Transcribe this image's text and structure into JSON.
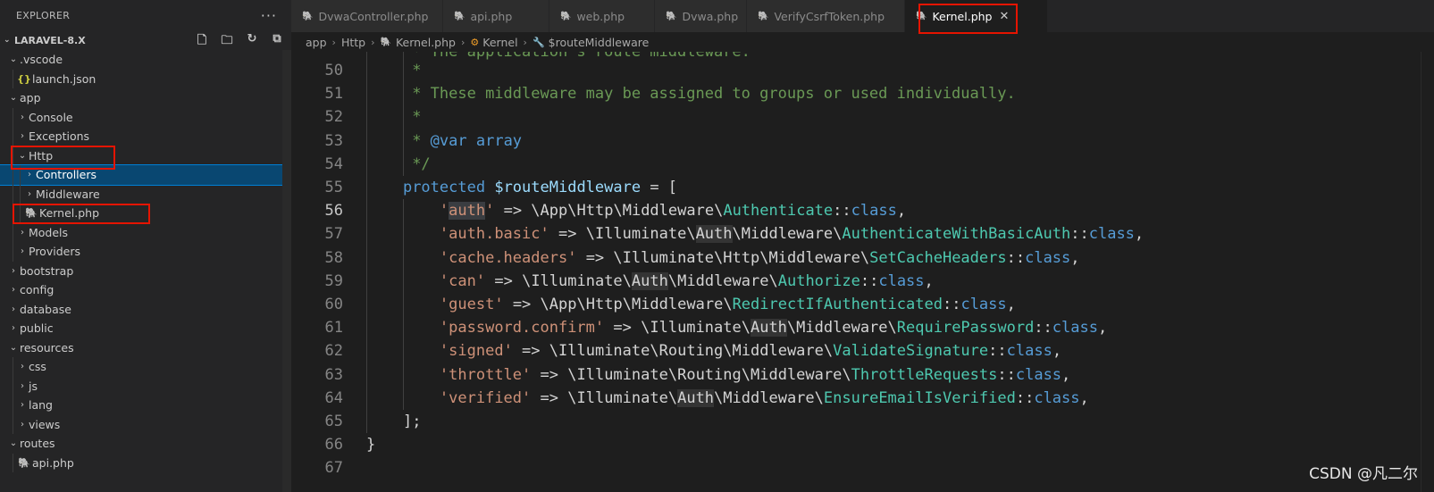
{
  "sidebar": {
    "title": "EXPLORER",
    "more_icon": "ellipsis-icon",
    "project": "LARAVEL-8.X",
    "actions": [
      "new-file-icon",
      "new-folder-icon",
      "refresh-icon",
      "collapse-all-icon"
    ],
    "items": [
      {
        "label": ".vscode",
        "type": "folder",
        "expanded": true
      },
      {
        "label": "launch.json",
        "type": "json"
      },
      {
        "label": "app",
        "type": "folder",
        "expanded": true
      },
      {
        "label": "Console",
        "type": "folder",
        "expanded": false
      },
      {
        "label": "Exceptions",
        "type": "folder",
        "expanded": false
      },
      {
        "label": "Http",
        "type": "folder",
        "expanded": true
      },
      {
        "label": "Controllers",
        "type": "folder",
        "expanded": false
      },
      {
        "label": "Middleware",
        "type": "folder",
        "expanded": false
      },
      {
        "label": "Kernel.php",
        "type": "php"
      },
      {
        "label": "Models",
        "type": "folder",
        "expanded": false
      },
      {
        "label": "Providers",
        "type": "folder",
        "expanded": false
      },
      {
        "label": "bootstrap",
        "type": "folder",
        "expanded": false
      },
      {
        "label": "config",
        "type": "folder",
        "expanded": false
      },
      {
        "label": "database",
        "type": "folder",
        "expanded": false
      },
      {
        "label": "public",
        "type": "folder",
        "expanded": false
      },
      {
        "label": "resources",
        "type": "folder",
        "expanded": true
      },
      {
        "label": "css",
        "type": "folder",
        "expanded": false
      },
      {
        "label": "js",
        "type": "folder",
        "expanded": false
      },
      {
        "label": "lang",
        "type": "folder",
        "expanded": false
      },
      {
        "label": "views",
        "type": "folder",
        "expanded": false
      },
      {
        "label": "routes",
        "type": "folder",
        "expanded": true
      },
      {
        "label": "api.php",
        "type": "php"
      }
    ]
  },
  "tabs": [
    {
      "label": "DvwaController.php",
      "active": false
    },
    {
      "label": "api.php",
      "active": false
    },
    {
      "label": "web.php",
      "active": false
    },
    {
      "label": "Dvwa.php",
      "active": false
    },
    {
      "label": "VerifyCsrfToken.php",
      "active": false
    },
    {
      "label": "Kernel.php",
      "active": true
    }
  ],
  "breadcrumb": [
    "app",
    "Http",
    "Kernel.php",
    "Kernel",
    "$routeMiddleware"
  ],
  "editor": {
    "current_line": 56,
    "line_numbers": [
      "50",
      "51",
      "52",
      "53",
      "54",
      "55",
      "56",
      "57",
      "58",
      "59",
      "60",
      "61",
      "62",
      "63",
      "64",
      "65",
      "66",
      "67"
    ],
    "partial_top": "* The application's route middleware.",
    "comment_star": "*",
    "comment_51": "* These middleware may be assigned to groups or used individually.",
    "comment_53_star": "* ",
    "comment_53_tag": "@var",
    "comment_53_type": " array",
    "comment_54": "*/",
    "kw_protected": "protected",
    "var_routeMiddleware": "$routeMiddleware",
    "assign_open": " = [",
    "arrow": " => ",
    "sep": "\\",
    "dcolon": "::",
    "kw_class": "class",
    "comma": ",",
    "close_bracket": "];",
    "close_brace": "}",
    "entries": [
      {
        "key": "auth",
        "ns": [
          "App",
          "Http",
          "Middleware"
        ],
        "cls": "Authenticate"
      },
      {
        "key": "auth.basic",
        "ns": [
          "Illuminate",
          "Auth",
          "Middleware"
        ],
        "cls": "AuthenticateWithBasicAuth"
      },
      {
        "key": "cache.headers",
        "ns": [
          "Illuminate",
          "Http",
          "Middleware"
        ],
        "cls": "SetCacheHeaders"
      },
      {
        "key": "can",
        "ns": [
          "Illuminate",
          "Auth",
          "Middleware"
        ],
        "cls": "Authorize"
      },
      {
        "key": "guest",
        "ns": [
          "App",
          "Http",
          "Middleware"
        ],
        "cls": "RedirectIfAuthenticated"
      },
      {
        "key": "password.confirm",
        "ns": [
          "Illuminate",
          "Auth",
          "Middleware"
        ],
        "cls": "RequirePassword"
      },
      {
        "key": "signed",
        "ns": [
          "Illuminate",
          "Routing",
          "Middleware"
        ],
        "cls": "ValidateSignature"
      },
      {
        "key": "throttle",
        "ns": [
          "Illuminate",
          "Routing",
          "Middleware"
        ],
        "cls": "ThrottleRequests"
      },
      {
        "key": "verified",
        "ns": [
          "Illuminate",
          "Auth",
          "Middleware"
        ],
        "cls": "EnsureEmailIsVerified"
      }
    ]
  },
  "watermark": "CSDN @凡二尔",
  "colors": {
    "accent": "#007fd4",
    "highlight_box": "#e51400",
    "php_icon": "#a074c4"
  }
}
